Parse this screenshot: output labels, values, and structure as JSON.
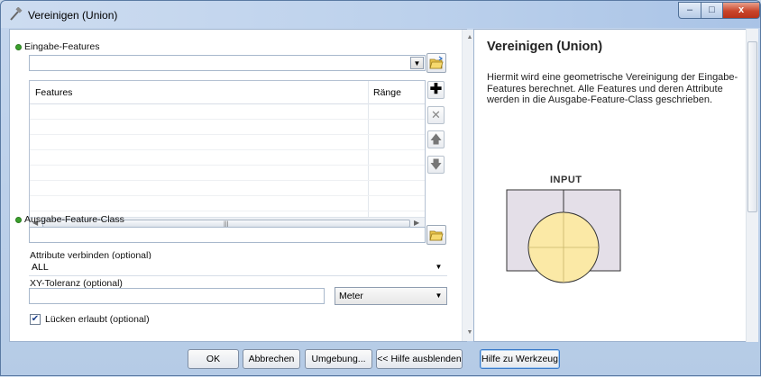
{
  "window": {
    "title": "Vereinigen (Union)",
    "controls": {
      "minimize": "–",
      "maximize": "□",
      "close": "x"
    }
  },
  "form": {
    "input_features": {
      "label": "Eingabe-Features",
      "value": "",
      "table": {
        "columns": [
          "Features",
          "Ränge"
        ],
        "rows": [
          [
            "",
            ""
          ],
          [
            "",
            ""
          ],
          [
            "",
            ""
          ],
          [
            "",
            ""
          ],
          [
            "",
            ""
          ],
          [
            "",
            ""
          ],
          [
            "",
            ""
          ]
        ]
      }
    },
    "output_feature_class": {
      "label": "Ausgabe-Feature-Class",
      "value": ""
    },
    "join_attributes": {
      "label": "Attribute verbinden (optional)",
      "value": "ALL"
    },
    "xy_tolerance": {
      "label": "XY-Toleranz (optional)",
      "value": "",
      "unit": "Meter"
    },
    "gaps_allowed": {
      "label": "Lücken erlaubt (optional)",
      "checked": true
    }
  },
  "help": {
    "title": "Vereinigen (Union)",
    "text": "Hiermit wird eine geometrische Vereinigung der Eingabe-Features berechnet. Alle Features und deren Attribute werden in die Ausgabe-Feature-Class geschrieben.",
    "diagram_label": "INPUT"
  },
  "buttons": {
    "ok": "OK",
    "cancel": "Abbrechen",
    "environments": "Umgebung...",
    "hide_help": "<< Hilfe ausblenden",
    "tool_help": "Hilfe zu Werkzeug"
  },
  "icons": {
    "app": "hammer-icon",
    "browse": "folder-open-icon",
    "add": "plus-icon",
    "remove": "x-icon",
    "up": "arrow-up-icon",
    "down": "arrow-down-icon"
  }
}
